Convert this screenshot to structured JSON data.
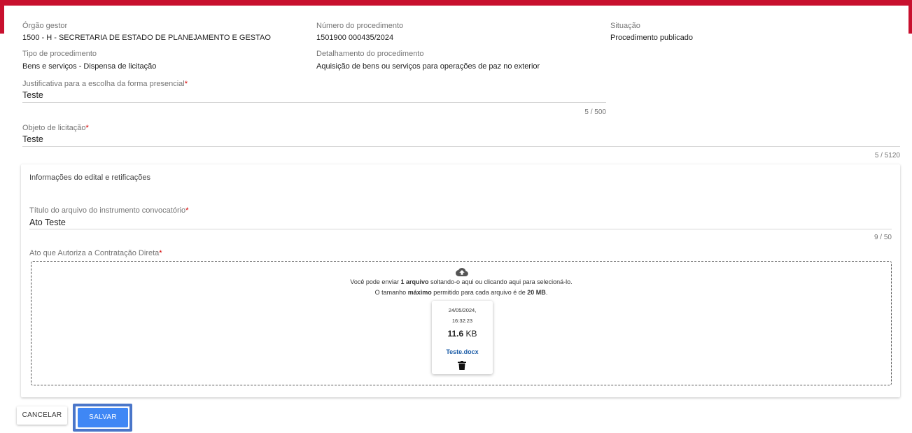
{
  "header": {
    "orgao_label": "Órgão gestor",
    "orgao_value": "1500 - H - SECRETARIA DE ESTADO DE PLANEJAMENTO E GESTAO",
    "numero_label": "Número do procedimento",
    "numero_value": "1501900 000435/2024",
    "situacao_label": "Situação",
    "situacao_value": "Procedimento publicado",
    "tipo_label": "Tipo de procedimento",
    "tipo_value": "Bens e serviços - Dispensa de licitação",
    "detalhamento_label": "Detalhamento do procedimento",
    "detalhamento_value": "Aquisição de bens ou serviços para operações de paz no exterior"
  },
  "justificativa": {
    "label": "Justificativa para a escolha da forma presencial",
    "required_mark": "*",
    "value": "Teste",
    "counter": "5 / 500"
  },
  "objeto": {
    "label": "Objeto de licitação",
    "required_mark": "*",
    "value": "Teste",
    "counter": "5 / 5120"
  },
  "edital": {
    "title": "Informações do edital e retificações",
    "titulo_arquivo": {
      "label": "Título do arquivo do instrumento convocatório",
      "required_mark": "*",
      "value": "Ato Teste",
      "counter": "9 / 50"
    },
    "ato": {
      "label": "Ato que Autoriza a Contratação Direta",
      "required_mark": "*"
    },
    "dropzone": {
      "icon": "cloud-upload-icon",
      "line1_a": "Você pode enviar ",
      "line1_b": "1 arquivo",
      "line1_c": " soltando-o aqui ou clicando aqui para selecioná-lo.",
      "line2_a": "O tamanho ",
      "line2_b": "máximo",
      "line2_c": " permitido para cada arquivo é de ",
      "line2_d": "20 MB",
      "line2_e": ".",
      "file": {
        "date": "24/05/2024,",
        "time": "16:32:23",
        "size_num": "11.6",
        "size_unit": " KB",
        "name": "Teste.docx",
        "delete_icon": "trash-icon"
      }
    }
  },
  "actions": {
    "cancel_label": "CANCELAR",
    "save_label": "SALVAR"
  },
  "colors": {
    "brand": "#c8102e",
    "primary": "#3f87f5",
    "link": "#1e5ea8",
    "required": "#d50000"
  }
}
